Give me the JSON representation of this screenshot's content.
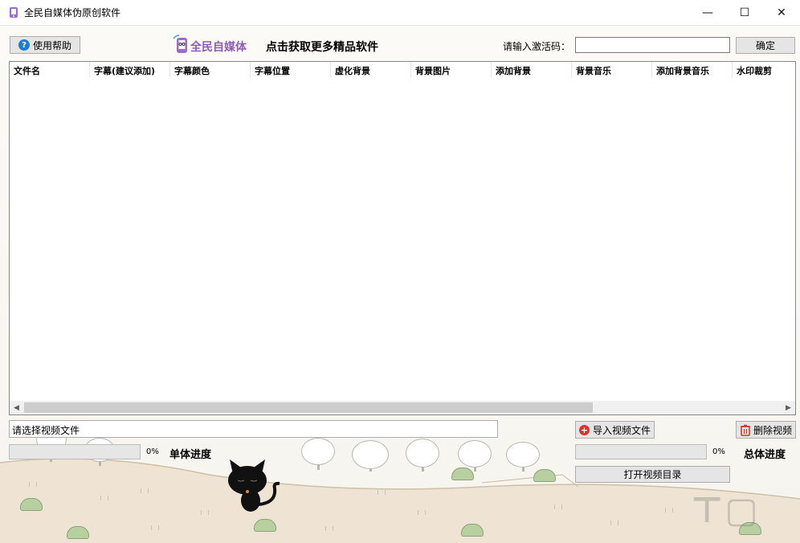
{
  "window": {
    "title": "全民自媒体伪原创软件",
    "controls": {
      "minimize": "—",
      "maximize": "☐",
      "close": "✕"
    }
  },
  "toolbar": {
    "help_label": "使用帮助",
    "brand_name": "全民自媒体",
    "promo_link": "点击获取更多精品软件",
    "activation_label": "请输入激活码：",
    "activation_value": "",
    "confirm_label": "确定"
  },
  "table": {
    "columns": [
      "文件名",
      "字幕(建议添加)",
      "字幕颜色",
      "字幕位置",
      "虚化背景",
      "背景图片",
      "添加背景",
      "背景音乐",
      "添加背景音乐",
      "水印裁剪"
    ],
    "rows": []
  },
  "bottom": {
    "file_status": "请选择视频文件",
    "import_label": "导入视频文件",
    "delete_label": "删除视频",
    "single_percent": "0%",
    "single_label": "单体进度",
    "single_progress": 0,
    "total_percent": "0%",
    "total_label": "总体进度",
    "total_progress": 0,
    "open_dir_label": "打开视频目录"
  },
  "icons": {
    "help": "question-circle-icon",
    "import": "plus-circle-icon",
    "delete": "trash-icon",
    "app": "app-logo-icon",
    "brand": "brand-phone-logo-icon"
  },
  "colors": {
    "brand": "#8e5bb8",
    "help_icon": "#1e7bd6",
    "import_icon": "#d9342b",
    "progress_fill": "#06b025"
  }
}
